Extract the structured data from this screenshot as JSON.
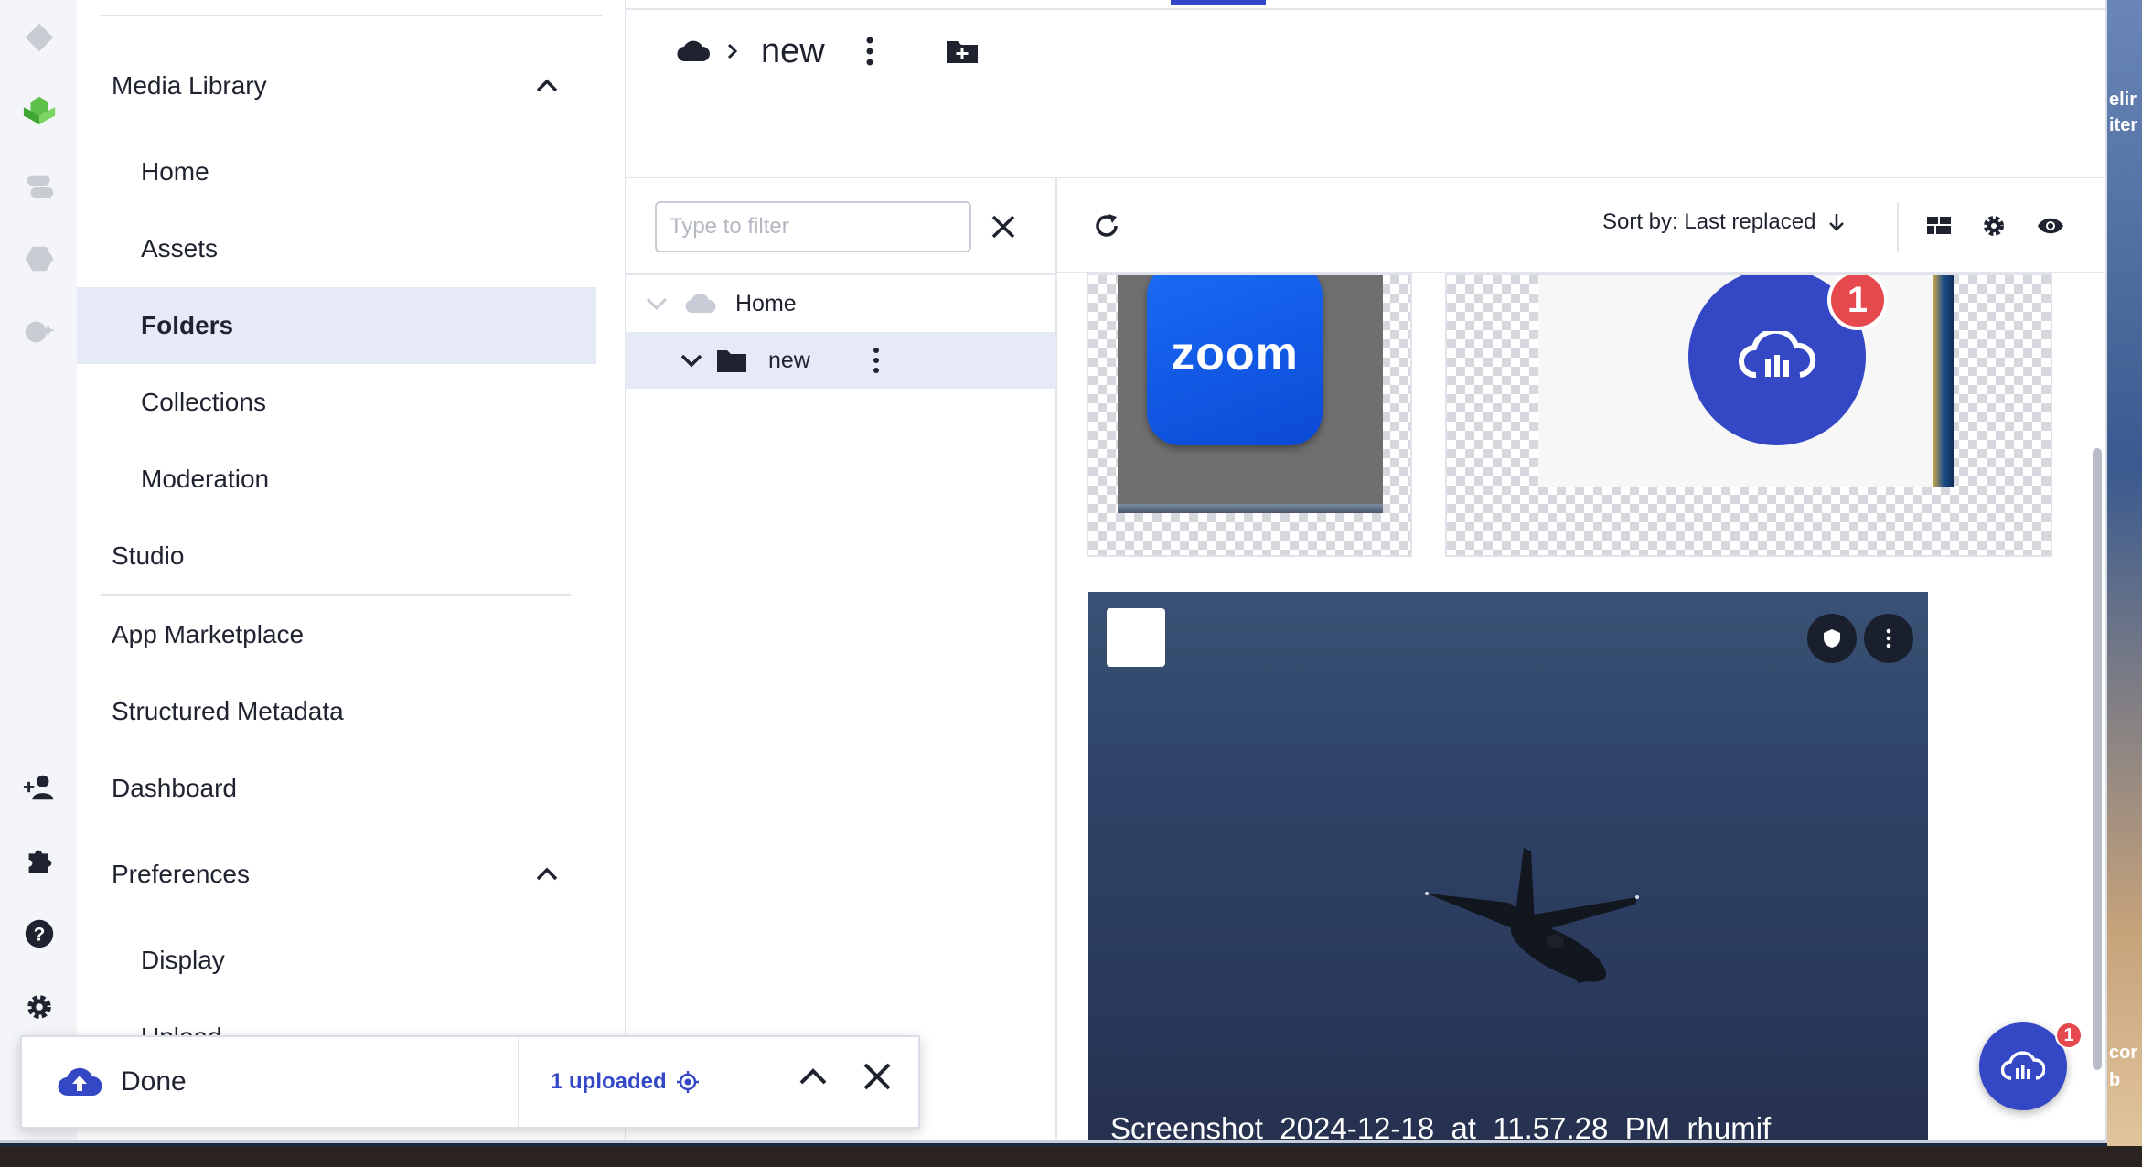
{
  "sidebar": {
    "items": [
      {
        "label": "Media Library"
      },
      {
        "label": "Home"
      },
      {
        "label": "Assets"
      },
      {
        "label": "Folders"
      },
      {
        "label": "Collections"
      },
      {
        "label": "Moderation"
      },
      {
        "label": "Studio"
      },
      {
        "label": "App Marketplace"
      },
      {
        "label": "Structured Metadata"
      },
      {
        "label": "Dashboard"
      },
      {
        "label": "Preferences"
      },
      {
        "label": "Display"
      },
      {
        "label": "Upload"
      }
    ]
  },
  "breadcrumb": {
    "current": "new"
  },
  "tree": {
    "filter_placeholder": "Type to filter",
    "home_label": "Home",
    "folder_label": "new"
  },
  "toolbar": {
    "sort_label": "Sort by: Last replaced"
  },
  "assets": {
    "zoom_logo_text": "zoom",
    "cloud_badge": "1",
    "plane_title": "Screenshot_2024-12-18_at_11.57.28_PM_rhumif"
  },
  "fab": {
    "badge": "1"
  },
  "toast": {
    "status": "Done",
    "count": "1 uploaded"
  },
  "desktop": {
    "text1": "elir",
    "text2": "iter",
    "text3": "cor",
    "text4": "b"
  },
  "colors": {
    "accent": "#3448c5",
    "badge": "#e5484d",
    "selected_bg": "#e6e9f6"
  }
}
